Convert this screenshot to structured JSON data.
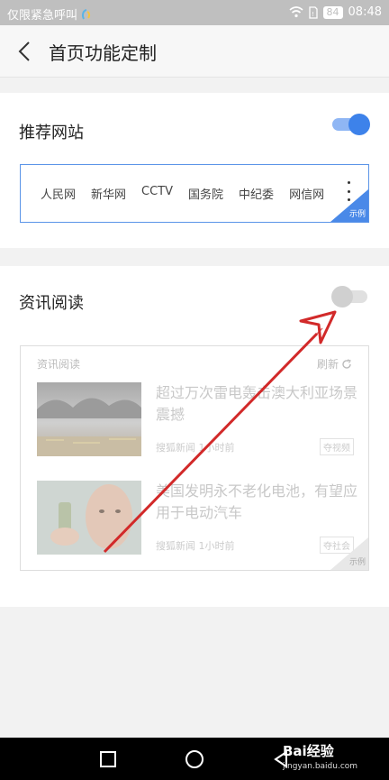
{
  "status_bar": {
    "carrier_text": "仅限紧急呼叫",
    "battery": "84",
    "time": "08:48",
    "icons": [
      "wifi-icon",
      "sim-icon",
      "battery-icon"
    ]
  },
  "header": {
    "title": "首页功能定制",
    "back_icon": "chevron-left-icon"
  },
  "recommended_sites": {
    "label": "推荐网站",
    "enabled": true,
    "sites": [
      "人民网",
      "新华网",
      "CCTV",
      "国务院",
      "中纪委",
      "网信网"
    ],
    "more_icon": "vertical-ellipsis-icon",
    "example_label": "示例"
  },
  "news_reading": {
    "label": "资讯阅读",
    "enabled": false,
    "preview_title": "资讯阅读",
    "refresh_label": "刷新",
    "items": [
      {
        "headline": "超过万次雷电轰击澳大利亚场景震撼",
        "source": "搜狐新闻",
        "time": "1小时前",
        "tag": "夺视频"
      },
      {
        "headline": "美国发明永不老化电池，有望应用于电动汽车",
        "source": "搜狐新闻",
        "time": "1小时前",
        "tag": "夺社会"
      }
    ],
    "example_label": "示例"
  },
  "watermark": {
    "brand": "Bai经验",
    "url": "jingyan.baidu.com"
  },
  "colors": {
    "accent": "#3d82ea",
    "toggle_on_track": "#8fb6f4",
    "toggle_off_knob": "#d0d0d0",
    "annotation_arrow": "#d22a2a"
  }
}
